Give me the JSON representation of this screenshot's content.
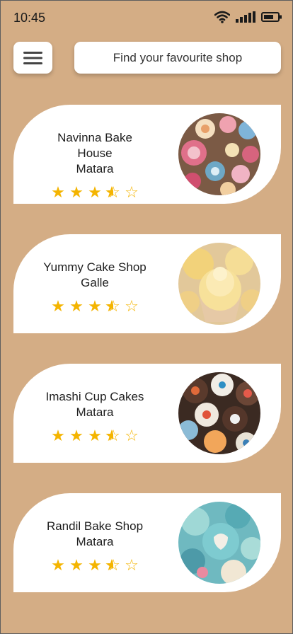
{
  "status_bar": {
    "time": "10:45",
    "icons": [
      "wifi-icon",
      "signal-icon",
      "battery-icon"
    ]
  },
  "header": {
    "menu_icon": "hamburger-menu-icon",
    "search_text": "Find your favourite shop"
  },
  "colors": {
    "background": "#d4ad85",
    "card": "#ffffff",
    "star": "#f4b400"
  },
  "shops": [
    {
      "name": "Navinna Bake House",
      "town": "Matara",
      "rating": 3.5,
      "photo": "cupcakes-assorted-pastel"
    },
    {
      "name": "Yummy  Cake Shop",
      "town": "Galle",
      "rating": 3.5,
      "photo": "vanilla-cupcakes"
    },
    {
      "name": "Imashi Cup Cakes",
      "town": "Matara",
      "rating": 3.5,
      "photo": "chocolate-flower-cupcakes"
    },
    {
      "name": "Randil Bake Shop",
      "town": "Matara",
      "rating": 3.5,
      "photo": "turquoise-decorated-cupcakes"
    }
  ]
}
